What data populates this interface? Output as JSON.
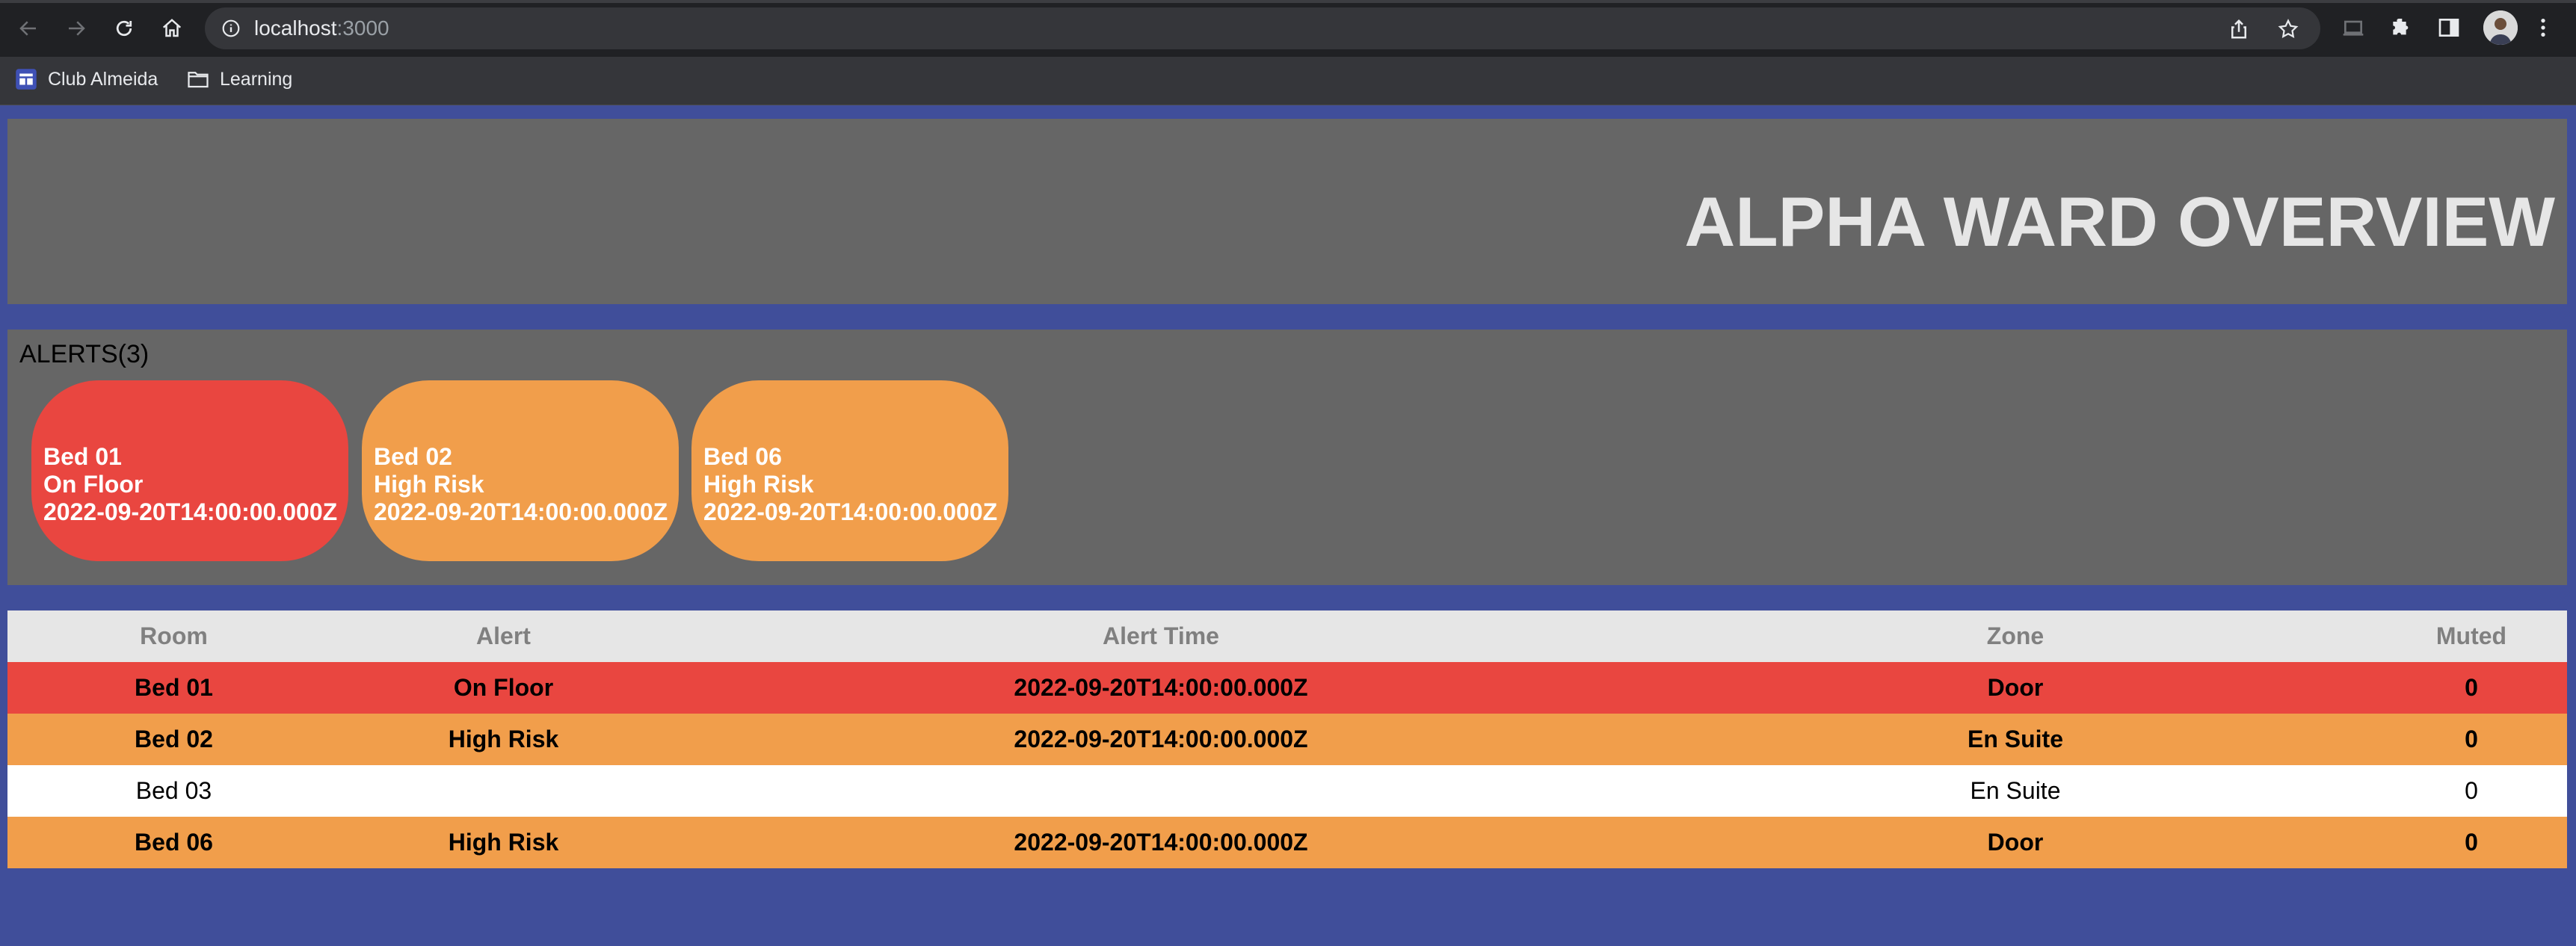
{
  "browser": {
    "url_host": "localhost",
    "url_port": ":3000",
    "bookmarks": [
      {
        "label": "Club Almeida",
        "icon": "club-almeida-favicon"
      },
      {
        "label": "Learning",
        "icon": "folder-icon"
      }
    ]
  },
  "header": {
    "title": "ALPHA WARD OVERVIEW"
  },
  "alerts": {
    "heading": "ALERTS(3)",
    "cards": [
      {
        "bed": "Bed 01",
        "alert": "On Floor",
        "time": "2022-09-20T14:00:00.000Z",
        "color": "#e94640"
      },
      {
        "bed": "Bed 02",
        "alert": "High Risk",
        "time": "2022-09-20T14:00:00.000Z",
        "color": "#f19e4b"
      },
      {
        "bed": "Bed 06",
        "alert": "High Risk",
        "time": "2022-09-20T14:00:00.000Z",
        "color": "#f19e4b"
      }
    ]
  },
  "table": {
    "columns": [
      "Room",
      "Alert",
      "Alert Time",
      "Zone",
      "Muted"
    ],
    "rows": [
      {
        "room": "Bed 01",
        "alert": "On Floor",
        "alert_time": "2022-09-20T14:00:00.000Z",
        "zone": "Door",
        "muted": "0",
        "status": "red"
      },
      {
        "room": "Bed 02",
        "alert": "High Risk",
        "alert_time": "2022-09-20T14:00:00.000Z",
        "zone": "En Suite",
        "muted": "0",
        "status": "orange"
      },
      {
        "room": "Bed 03",
        "alert": "",
        "alert_time": "",
        "zone": "En Suite",
        "muted": "0",
        "status": "white"
      },
      {
        "room": "Bed 06",
        "alert": "High Risk",
        "alert_time": "2022-09-20T14:00:00.000Z",
        "zone": "Door",
        "muted": "0",
        "status": "orange"
      }
    ]
  },
  "colors": {
    "page_background": "#404e9a",
    "panel": "#666666",
    "alert_red": "#e94640",
    "alert_orange": "#f19e4b"
  }
}
